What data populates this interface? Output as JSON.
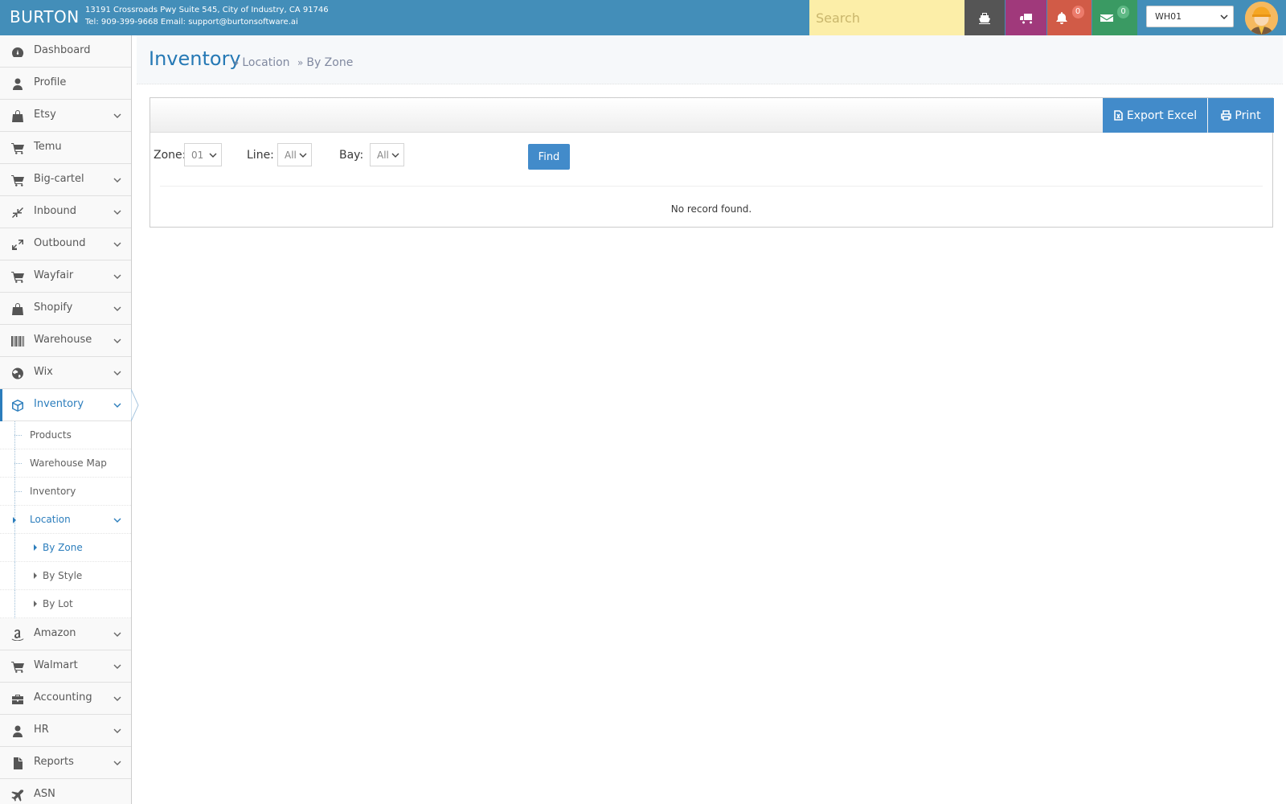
{
  "navbar": {
    "brand": "BURTON",
    "address": "13191 Crossroads Pwy Suite 545, City of Industry, CA 91746",
    "contact": "Tel: 909-399-9668 Email: support@burtonsoftware.ai",
    "search_placeholder": "Search",
    "notifications_count": "0",
    "messages_count": "0",
    "warehouse": "WH01",
    "colors": {
      "bar": "#438eb9",
      "ship": "#555555",
      "truck": "#a0397b",
      "bell": "#d15b47",
      "mail": "#3a9a63",
      "search": "#fceea8"
    }
  },
  "sidebar": {
    "items": [
      {
        "label": "Dashboard",
        "icon": "dashboard-icon"
      },
      {
        "label": "Profile",
        "icon": "user-icon"
      },
      {
        "label": "Etsy",
        "icon": "shopping-bag-icon"
      },
      {
        "label": "Temu",
        "icon": "cart-icon"
      },
      {
        "label": "Big-cartel",
        "icon": "cart-icon"
      },
      {
        "label": "Inbound",
        "icon": "compress-icon"
      },
      {
        "label": "Outbound",
        "icon": "expand-icon"
      },
      {
        "label": "Wayfair",
        "icon": "cart-icon"
      },
      {
        "label": "Shopify",
        "icon": "shopping-bag-icon"
      },
      {
        "label": "Warehouse",
        "icon": "barcode-icon"
      },
      {
        "label": "Wix",
        "icon": "globe-icon"
      },
      {
        "label": "Inventory",
        "icon": "cube-icon"
      },
      {
        "label": "Amazon",
        "icon": "amazon-icon"
      },
      {
        "label": "Walmart",
        "icon": "cart-icon"
      },
      {
        "label": "Accounting",
        "icon": "briefcase-icon"
      },
      {
        "label": "HR",
        "icon": "user-icon"
      },
      {
        "label": "Reports",
        "icon": "file-icon"
      },
      {
        "label": "ASN",
        "icon": "plane-icon"
      }
    ],
    "inventory_sub": [
      "Products",
      "Warehouse Map",
      "Inventory",
      "Location"
    ],
    "location_sub": [
      "By Zone",
      "By Style",
      "By Lot"
    ]
  },
  "page": {
    "title": "Inventory",
    "breadcrumb": [
      "Location",
      "By Zone"
    ]
  },
  "toolbar": {
    "export_label": "Export Excel",
    "print_label": "Print"
  },
  "filters": {
    "zone_label": "Zone:",
    "zone_value": "01",
    "line_label": "Line:",
    "line_value": "All",
    "bay_label": "Bay:",
    "bay_value": "All",
    "find_label": "Find"
  },
  "results": {
    "empty_message": "No record found."
  }
}
